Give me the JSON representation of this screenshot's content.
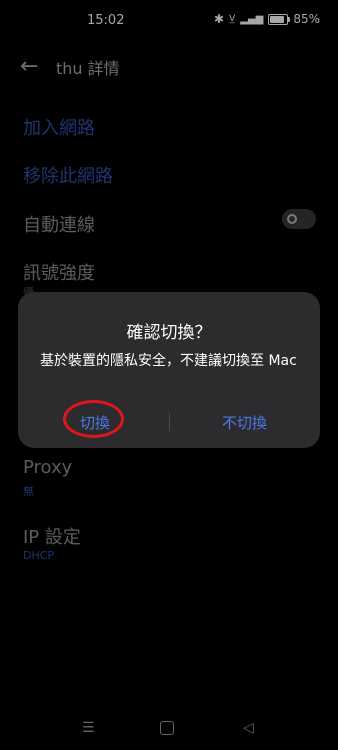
{
  "status_bar": {
    "time": "15:02",
    "battery_percent": "85%",
    "battery_level": 0.85,
    "icons": [
      "bluetooth-icon",
      "volte-icon",
      "signal-icon",
      "battery-icon"
    ]
  },
  "header": {
    "back_icon": "arrow-left-icon",
    "title": "thu 詳情"
  },
  "settings": {
    "join_network": "加入網路",
    "remove_network": "移除此網路",
    "auto_connect": "自動連線",
    "auto_connect_on": false,
    "signal_strength": "訊號強度",
    "signal_strength_value": "優",
    "proxy": "Proxy",
    "proxy_value": "無",
    "ip_settings": "IP 設定",
    "ip_settings_value": "DHCP"
  },
  "dialog": {
    "title": "確認切換？",
    "message": "基於裝置的隱私安全，不建議切換至 Mac",
    "confirm_label": "切換",
    "cancel_label": "不切換",
    "accent_color": "#4a7ae8",
    "highlight_color": "#e0161b"
  },
  "navbar": {
    "menu_icon": "menu-icon",
    "home_icon": "home-icon",
    "back_icon": "back-triangle-icon"
  }
}
